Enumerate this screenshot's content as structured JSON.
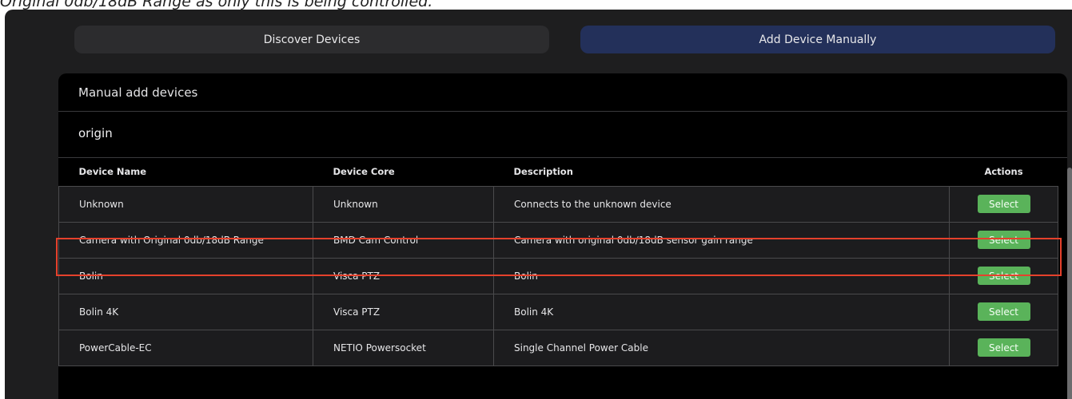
{
  "caption": "Original 0db/18dB Range as only this is being controlled.",
  "tabs": {
    "discover_label": "Discover Devices",
    "manual_label": "Add Device Manually"
  },
  "panel": {
    "title": "Manual add devices",
    "search_value": "origin"
  },
  "table": {
    "headers": {
      "device_name": "Device Name",
      "device_core": "Device Core",
      "description": "Description",
      "actions": "Actions"
    },
    "rows": [
      {
        "device_name": "Unknown",
        "device_core": "Unknown",
        "description": "Connects to the unknown device",
        "action": "Select"
      },
      {
        "device_name": "Camera with Original 0db/18dB Range",
        "device_core": "BMD Cam Control",
        "description": "Camera with original 0db/18dB sensor gain range",
        "action": "Select"
      },
      {
        "device_name": "Bolin",
        "device_core": "Visca PTZ",
        "description": "Bolin",
        "action": "Select"
      },
      {
        "device_name": "Bolin 4K",
        "device_core": "Visca PTZ",
        "description": "Bolin 4K",
        "action": "Select"
      },
      {
        "device_name": "PowerCable-EC",
        "device_core": "NETIO Powersocket",
        "description": "Single Channel Power Cable",
        "action": "Select"
      }
    ]
  },
  "colors": {
    "accent_tab": "#23305a",
    "select_button": "#5ab35a",
    "highlight_box": "#e5412c"
  }
}
